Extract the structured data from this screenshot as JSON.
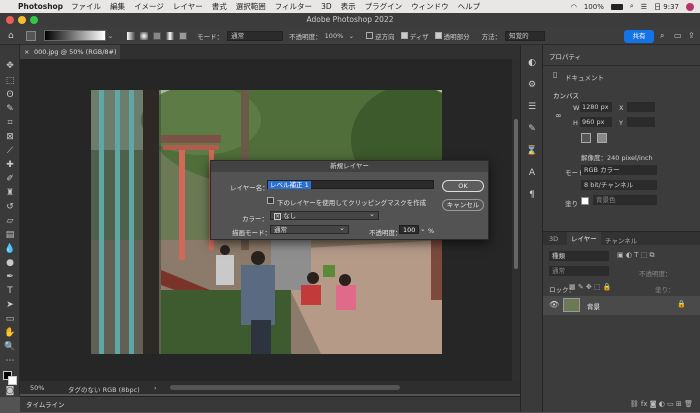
{
  "menubar": {
    "apple": "",
    "app_name": "Photoshop",
    "items": [
      "ファイル",
      "編集",
      "イメージ",
      "レイヤー",
      "書式",
      "選択範囲",
      "フィルター",
      "3D",
      "表示",
      "プラグイン",
      "ウィンドウ",
      "ヘルプ"
    ],
    "status": {
      "battery": "100%",
      "time": "日 9:37"
    }
  },
  "window": {
    "title": "Adobe Photoshop 2022"
  },
  "options_bar": {
    "mode_label": "モード：",
    "mode_value": "通常",
    "opacity_label": "不透明度：",
    "opacity_value": "100%",
    "reverse_label": "逆方向",
    "dither_label": "ディザ",
    "transparency_label": "透明部分",
    "method_label": "方法：",
    "method_value": "知覚的",
    "share_label": "共有"
  },
  "document_tab": {
    "label": "000.jpg @ 50% (RGB/8#)",
    "close": "×"
  },
  "statusbar": {
    "zoom": "50%",
    "profile": "タグのない RGB (8bpc)",
    "arrow": "›"
  },
  "timeline": {
    "label": "タイムライン"
  },
  "dialog": {
    "title": "新規レイヤー",
    "name_label": "レイヤー名：",
    "name_value": "レベル補正 1",
    "clip_label": "下のレイヤーを使用してクリッピングマスクを作成",
    "color_label": "カラー：",
    "color_value": "なし",
    "blend_label": "描画モード：",
    "blend_value": "通常",
    "opacity_label": "不透明度：",
    "opacity_value": "100",
    "opacity_unit": "%",
    "ok_label": "OK",
    "cancel_label": "キャンセル"
  },
  "properties": {
    "title": "プロパティ",
    "doc_label": "ドキュメント",
    "canvas_section": "カンバス",
    "w_label": "W",
    "w_value": "1280 px",
    "h_label": "H",
    "h_value": "960 px",
    "x_label": "X",
    "y_label": "Y",
    "resolution": "解像度：240 pixel/inch",
    "mode_label": "モード",
    "mode_value": "RGB カラー",
    "depth_value": "8 bit/チャンネル",
    "fill_label": "塗り",
    "fill_value": "背景色"
  },
  "layers": {
    "tabs": [
      "3D",
      "レイヤー",
      "チャンネル"
    ],
    "filter_label": "種類",
    "blend_value": "通常",
    "opacity_label": "不透明度：",
    "lock_label": "ロック：",
    "fill_label": "塗り：",
    "layer_name": "背景"
  }
}
